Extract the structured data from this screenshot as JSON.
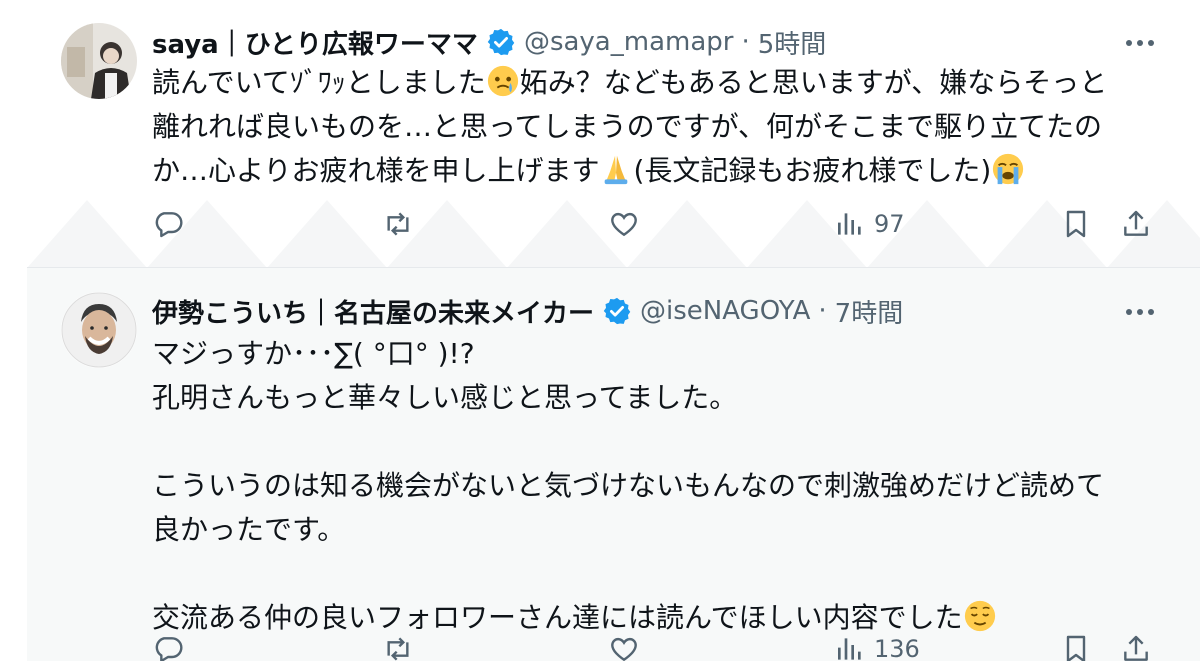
{
  "tweets": [
    {
      "name": "saya｜ひとり広報ワーママ",
      "handle": "@saya_mamapr",
      "separator": "·",
      "time": "5時間",
      "text_parts": [
        "読んでいてｿﾞﾜｯとしました",
        "妬み？などもあると思いますが、嫌ならそっと\n離れれば良いものを…と思ってしまうのですが、何がそこまで駆り立てたの\nか…心よりお疲れ様を申し上げます",
        "(長文記録もお疲れ様でした)"
      ],
      "views": "97"
    },
    {
      "name": "伊勢こういち｜名古屋の未来メイカー",
      "handle": "@iseNAGOYA",
      "separator": "·",
      "time": "7時間",
      "text_parts": [
        "マジっすか･･･∑( °口° )!?\n孔明さんもっと華々しい感じと思ってました。\n\nこういうのは知る機会がないと気づけないもんなので刺激強めだけど読めて\n良かったです。\n\n交流ある仲の良いフォロワーさん達には読んでほしい内容でした"
      ],
      "views": "136"
    }
  ],
  "icons": {
    "more": "more-icon",
    "reply": "reply-icon",
    "retweet": "retweet-icon",
    "like": "like-icon",
    "views": "views-icon",
    "bookmark": "bookmark-icon",
    "share": "share-icon",
    "verified": "verified-badge-icon"
  },
  "colors": {
    "verified": "#1d9bf0",
    "secondary_text": "#536471",
    "highlight_bg": "#f7f9f9"
  }
}
